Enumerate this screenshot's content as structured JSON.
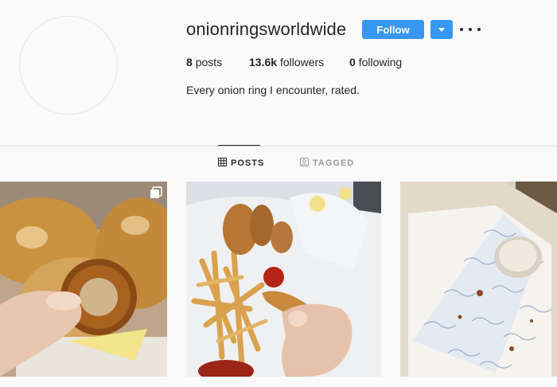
{
  "profile": {
    "username": "onionringsworldwide",
    "follow_label": "Follow",
    "stats": {
      "posts_count": "8",
      "posts_label": "posts",
      "followers_count": "13.6k",
      "followers_label": "followers",
      "following_count": "0",
      "following_label": "following"
    },
    "bio": "Every onion ring I encounter, rated."
  },
  "tabs": [
    {
      "label": "POSTS",
      "icon": "grid-icon",
      "active": true
    },
    {
      "label": "TAGGED",
      "icon": "tagged-icon",
      "active": false
    }
  ],
  "posts": [
    {
      "description": "onion ring held over fried fish",
      "multi_image": true
    },
    {
      "description": "fish and chips with ketchup-dipped onion ring",
      "multi_image": false
    },
    {
      "description": "paper-lined box with dip",
      "multi_image": false
    }
  ],
  "colors": {
    "accent": "#3897f0",
    "background": "#fafafa",
    "text": "#262626",
    "muted": "#999999",
    "divider": "#dbdbdb"
  }
}
